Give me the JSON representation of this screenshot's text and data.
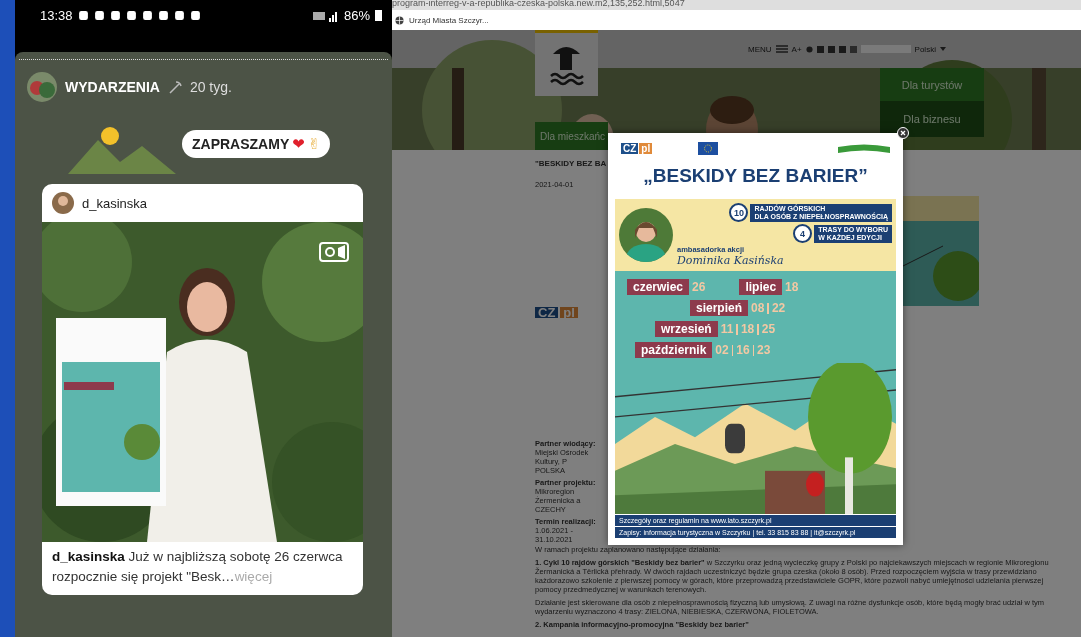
{
  "status_bar": {
    "time": "13:38",
    "battery": "86%"
  },
  "story": {
    "account": "WYDARZENIA",
    "age": "20 tyg.",
    "sticker": {
      "text": "ZAPRASZAMY",
      "emoji": [
        "❤",
        "✌"
      ]
    },
    "post": {
      "username": "d_kasinska",
      "caption_user": "d_kasinska",
      "caption": "Już w najbliższą sobotę 26 czerwca  rozpocznie się projekt \"Besk…",
      "more": "więcej"
    }
  },
  "browser": {
    "url": "program-interreg-v-a-republika-czeska-polska.new.m2,135,252.html,5047",
    "tab_title": "Urząd Miasta Szczyr..."
  },
  "site": {
    "menu_label": "MENU",
    "font_label": "A+",
    "language": "Polski",
    "nav": [
      {
        "label": "Dla turystów"
      },
      {
        "label": "Dla biznesu"
      },
      {
        "label": "Dla mieszkańc"
      }
    ],
    "article": {
      "title": "\"BESKIDY BEZ BA",
      "date": "2021-04-01",
      "logo": [
        "CZ",
        "pl"
      ],
      "partners": [
        {
          "label": "Partner wiodący:",
          "value": [
            "Miejski Ośrodek Kultury, P",
            "POLSKA"
          ]
        },
        {
          "label": "Partner projektu:",
          "value": [
            "Mikroregion Żermenicka a",
            "CZECHY"
          ]
        },
        {
          "label": "Termin realizacji:",
          "value": [
            "1.06.2021 - 31.10.2021"
          ]
        }
      ],
      "paragraphs": [
        "W ramach projektu zaplanowano następujące działania:",
        "**1. Cykl 10 rajdów górskich \"Beskidy bez barier\"** w Szczyrku oraz jedną wycieczkę grupy z Polski po najciekawszych miejscach w regionie Mikroregionu Žermanická a Těrlická přehrady. W dwóch rajdach uczestniczyć będzie grupa czeska (około 8 osób). Przed rozpoczęciem wyjścia w trasy przewidziano każdorazowo szkolenie z pierwszej pomocy w górach, które przeprowadzą przedstawiciele GOPR, które pozwoli nabyć umiejętności udzielania pierwszej pomocy przedmedycznej w warunkach terenowych.",
        "Działanie jest skierowane dla osób z niepełnosprawnością fizyczną lub umysłową. Z uwagi na różne dysfunkcje osób, które będą mogły brać udział w tym wydarzeniu wyznaczono 4 trasy: ZIELONA, NIEBIESKA, CZERWONA, FIOLETOWA.",
        "**2. Kampania informacyjno-promocyjna \"Beskidy bez barier\"**"
      ]
    }
  },
  "poster": {
    "logo": [
      "CZ",
      "pl"
    ],
    "title": "„BESKIDY BEZ BARIER”",
    "badges": [
      {
        "number": "10",
        "line1": "RAJDÓW GÓRSKICH",
        "line2": "DLA OSÓB Z NIEPEŁNOSPRAWNOŚCIĄ"
      },
      {
        "number": "4",
        "line1": "TRASY DO WYBORU",
        "line2": "W KAŻDEJ EDYCJI"
      }
    ],
    "ambassador_label": "ambasadorka akcji",
    "ambassador": "Dominika Kasińska",
    "months": [
      {
        "name": "czerwiec",
        "dates": [
          "26"
        ]
      },
      {
        "name": "lipiec",
        "dates": [
          "18"
        ]
      },
      {
        "name": "sierpień",
        "dates": [
          "08",
          "22"
        ]
      },
      {
        "name": "wrzesień",
        "dates": [
          "11",
          "18",
          "25"
        ]
      },
      {
        "name": "październik",
        "dates": [
          "02",
          "16",
          "23"
        ]
      }
    ],
    "footer": [
      "Szczegóły oraz regulamin na www.lato.szczyrk.pl",
      "Zapisy: informacja turystyczna w Szczyrku | tel. 33 815 83 88 | it@szczyrk.pl"
    ]
  }
}
